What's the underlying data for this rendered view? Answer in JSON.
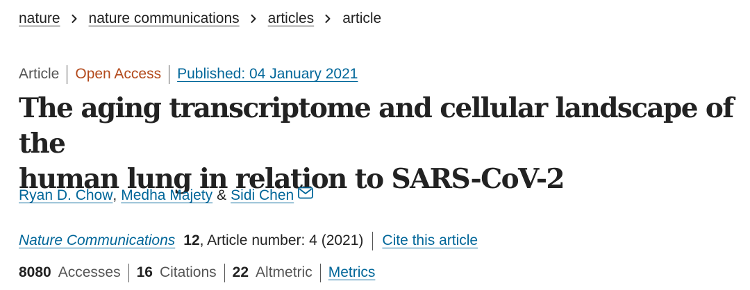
{
  "breadcrumb": {
    "items": [
      {
        "label": "nature"
      },
      {
        "label": "nature communications"
      },
      {
        "label": "articles"
      }
    ],
    "current": "article"
  },
  "meta": {
    "type": "Article",
    "access": "Open Access",
    "published": "Published: 04 January 2021"
  },
  "title": {
    "line1": "The aging transcriptome and cellular landscape of the",
    "line2": "human lung in relation to SARS-CoV-2"
  },
  "authors": {
    "a1": "Ryan D. Chow",
    "comma": ",",
    "a2": "Medha Majety",
    "amp": "&",
    "a3": "Sidi Chen"
  },
  "journal": {
    "name": "Nature Communications",
    "volume": "12",
    "article_number": ", Article number: 4 (2021)",
    "cite": "Cite this article"
  },
  "metrics": {
    "accesses_count": "8080",
    "accesses_label": "Accesses",
    "citations_count": "16",
    "citations_label": "Citations",
    "altmetric_count": "22",
    "altmetric_label": "Altmetric",
    "link": "Metrics"
  },
  "colors": {
    "link": "#006699",
    "open_access": "#b34a1c",
    "text": "#222222",
    "muted": "#555555"
  },
  "icons": {
    "breadcrumb_separator": "chevron-right-icon",
    "author_contact": "email-icon"
  }
}
